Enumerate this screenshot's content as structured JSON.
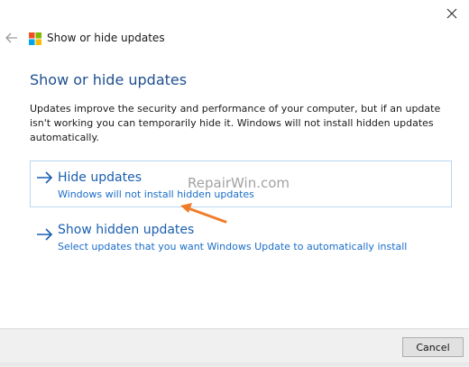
{
  "window": {
    "close_icon": "close-icon",
    "back_icon": "back-arrow-icon",
    "app_icon": "windows-logo-icon",
    "title": "Show or hide updates"
  },
  "content": {
    "heading": "Show or hide updates",
    "description": "Updates improve the security and performance of your computer, but if an update isn't working you can temporarily hide it. Windows will not install hidden updates automatically."
  },
  "options": [
    {
      "title": "Hide updates",
      "subtitle": "Windows will not install hidden updates",
      "selected": true
    },
    {
      "title": "Show hidden updates",
      "subtitle": "Select updates that you want Windows Update to automatically install",
      "selected": false
    }
  ],
  "watermark": "RepairWin.com",
  "footer": {
    "cancel_label": "Cancel"
  },
  "colors": {
    "accent": "#1a5fb0",
    "heading": "#1f4f8f",
    "annotation": "#f07c2a",
    "logo": [
      "#f25022",
      "#7fba00",
      "#00a4ef",
      "#ffb900"
    ]
  }
}
